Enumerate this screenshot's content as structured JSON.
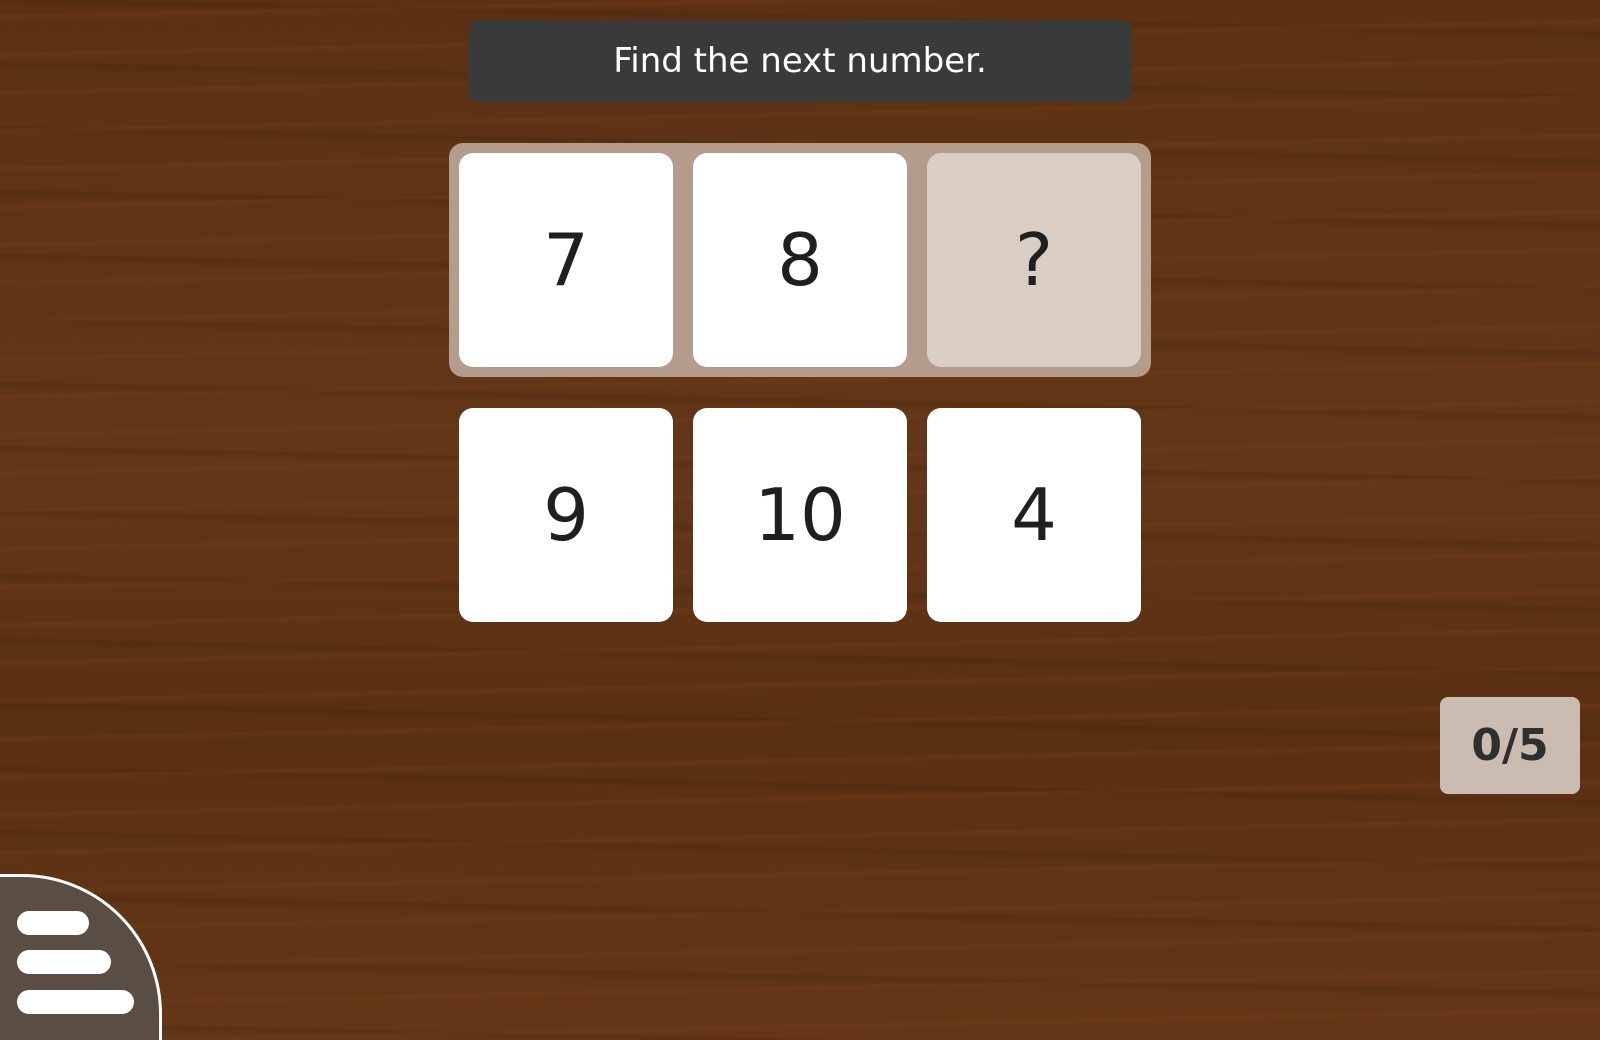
{
  "instruction": {
    "text": "Find the next number."
  },
  "sequence": {
    "tiles": [
      "7",
      "8",
      "?"
    ]
  },
  "answers": {
    "options": [
      "9",
      "10",
      "4"
    ]
  },
  "score": {
    "text": "0/5",
    "correct": 0,
    "total": 5
  },
  "menu": {
    "icon": "hamburger-menu-icon"
  },
  "colors": {
    "background": "#5d3214",
    "instruction_bar": "#3a3a3a",
    "tray": "#b39c8b",
    "empty_slot": "#d9cdc4",
    "score_box": "#cbbcb1",
    "menu_button": "#5a4d43"
  }
}
